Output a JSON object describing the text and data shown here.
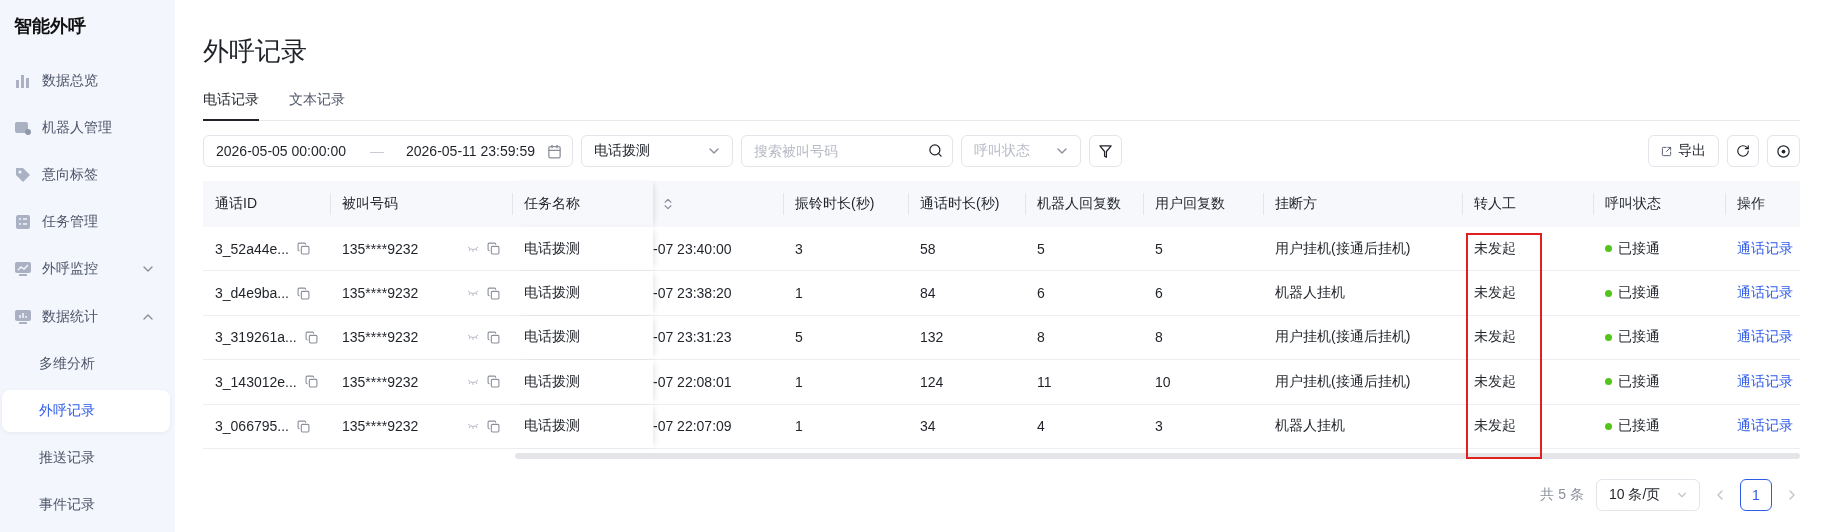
{
  "app_title": "智能外呼",
  "sidebar": {
    "items": [
      {
        "label": "数据总览",
        "selected": false
      },
      {
        "label": "机器人管理",
        "selected": false
      },
      {
        "label": "意向标签",
        "selected": false
      },
      {
        "label": "任务管理",
        "selected": false
      },
      {
        "label": "外呼监控",
        "selected": false,
        "expanded": false
      },
      {
        "label": "数据统计",
        "selected": false,
        "expanded": true,
        "children": [
          {
            "label": "多维分析",
            "selected": false
          },
          {
            "label": "外呼记录",
            "selected": true
          },
          {
            "label": "推送记录",
            "selected": false
          },
          {
            "label": "事件记录",
            "selected": false
          }
        ]
      }
    ]
  },
  "page_title": "外呼记录",
  "tabs": [
    {
      "label": "电话记录",
      "selected": true
    },
    {
      "label": "文本记录",
      "selected": false
    }
  ],
  "filters": {
    "date_start": "2026-05-05 00:00:00",
    "date_separator": "—",
    "date_end": "2026-05-11 23:59:59",
    "task_select": "电话拨测",
    "search": {
      "placeholder": "搜索被叫号码"
    },
    "status_select": {
      "placeholder": "呼叫状态"
    }
  },
  "actions": [
    {
      "label": "导出"
    }
  ],
  "table": {
    "columns": [
      {
        "kind": "text",
        "label": "通话ID"
      },
      {
        "kind": "text",
        "label": "被叫号码"
      },
      {
        "kind": "text",
        "label": "任务名称"
      },
      {
        "kind": "sort"
      },
      {
        "kind": "text",
        "label": "振铃时长(秒)"
      },
      {
        "kind": "text",
        "label": "通话时长(秒)"
      },
      {
        "kind": "text",
        "label": "机器人回复数"
      },
      {
        "kind": "text",
        "label": "用户回复数"
      },
      {
        "kind": "text",
        "label": "挂断方"
      },
      {
        "kind": "text",
        "label": "转人工",
        "highlighted": true
      },
      {
        "kind": "text",
        "label": "呼叫状态"
      },
      {
        "kind": "text",
        "label": "操作"
      }
    ],
    "rows": [
      {
        "call_id": "3_52a44e...",
        "phone": "135****9232",
        "task": "电话拨测",
        "time": "-07 23:40:00",
        "ring": "3",
        "duration": "58",
        "robot_replies": "5",
        "user_replies": "5",
        "hangup": "用户挂机(接通后挂机)",
        "transfer": "未发起",
        "status": "已接通",
        "action": "通话记录"
      },
      {
        "call_id": "3_d4e9ba...",
        "phone": "135****9232",
        "task": "电话拨测",
        "time": "-07 23:38:20",
        "ring": "1",
        "duration": "84",
        "robot_replies": "6",
        "user_replies": "6",
        "hangup": "机器人挂机",
        "transfer": "未发起",
        "status": "已接通",
        "action": "通话记录"
      },
      {
        "call_id": "3_319261a...",
        "phone": "135****9232",
        "task": "电话拨测",
        "time": "-07 23:31:23",
        "ring": "5",
        "duration": "132",
        "robot_replies": "8",
        "user_replies": "8",
        "hangup": "用户挂机(接通后挂机)",
        "transfer": "未发起",
        "status": "已接通",
        "action": "通话记录"
      },
      {
        "call_id": "3_143012e...",
        "phone": "135****9232",
        "task": "电话拨测",
        "time": "-07 22:08:01",
        "ring": "1",
        "duration": "124",
        "robot_replies": "11",
        "user_replies": "10",
        "hangup": "用户挂机(接通后挂机)",
        "transfer": "未发起",
        "status": "已接通",
        "action": "通话记录"
      },
      {
        "call_id": "3_066795...",
        "phone": "135****9232",
        "task": "电话拨测",
        "time": "-07 22:07:09",
        "ring": "1",
        "duration": "34",
        "robot_replies": "4",
        "user_replies": "3",
        "hangup": "机器人挂机",
        "transfer": "未发起",
        "status": "已接通",
        "action": "通话记录"
      }
    ]
  },
  "pagination": {
    "total": "共 5 条",
    "page_size": "10 条/页",
    "pages": [
      {
        "label": "1",
        "selected": true
      }
    ]
  }
}
